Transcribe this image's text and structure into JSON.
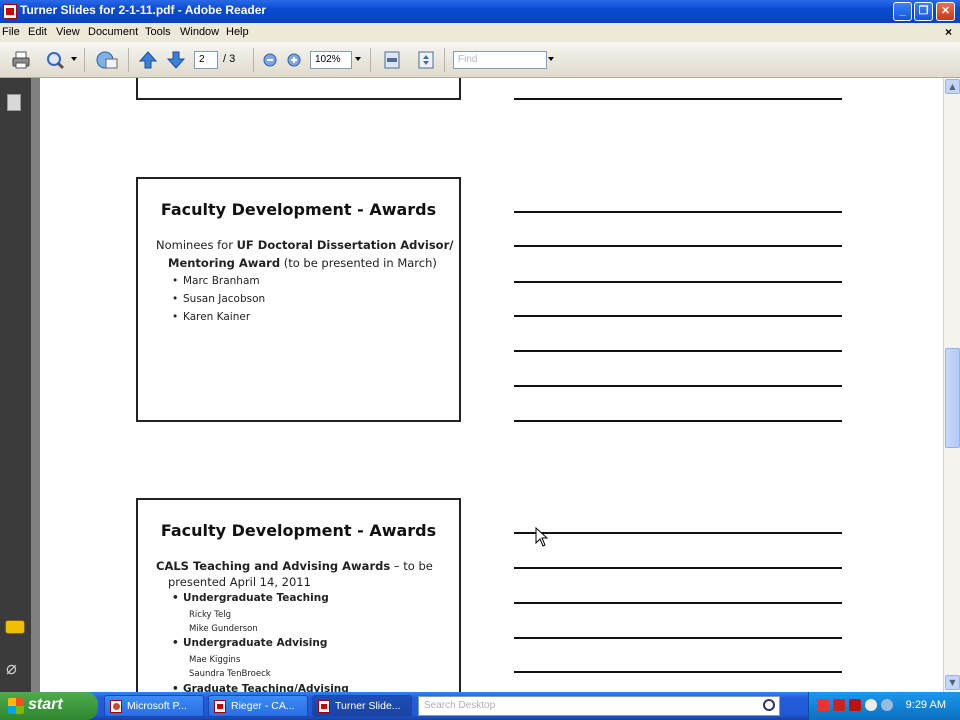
{
  "window": {
    "title": "Turner Slides for 2-1-11.pdf - Adobe Reader"
  },
  "menu": {
    "items": [
      "File",
      "Edit",
      "View",
      "Document",
      "Tools",
      "Window",
      "Help"
    ],
    "close_glyph": "×"
  },
  "toolbar": {
    "page_current": "2",
    "page_total": "/ 3",
    "zoom": "102%",
    "find_placeholder": "Find"
  },
  "slides": [
    {
      "title": "Faculty Development - Awards",
      "lead_plain": "Nominees for ",
      "lead_bold": "UF Doctoral Dissertation Advisor/",
      "lead2_bold": "Mentoring Award",
      "lead2_plain": " (to be presented in March)",
      "bullets": [
        "Marc Branham",
        "Susan Jacobson",
        "Karen Kainer"
      ]
    },
    {
      "title": "Faculty Development - Awards",
      "lead_bold": "CALS Teaching and Advising Awards",
      "lead_plain": " – to be",
      "lead2_plain": "presented April 14, 2011",
      "groups": [
        {
          "label": "Undergraduate Teaching",
          "names": [
            "Ricky Telg",
            "Mike Gunderson"
          ]
        },
        {
          "label": "Undergraduate Advising",
          "names": [
            "Mae Kiggins",
            "Saundra TenBroeck"
          ]
        },
        {
          "label": "Graduate Teaching/Advising",
          "names": []
        }
      ]
    }
  ],
  "taskbar": {
    "start_label": "start",
    "buttons": [
      "Microsoft P...",
      "Rieger - CA...",
      "Turner Slide..."
    ],
    "search_placeholder": "Search Desktop",
    "clock": "9:29 AM"
  }
}
